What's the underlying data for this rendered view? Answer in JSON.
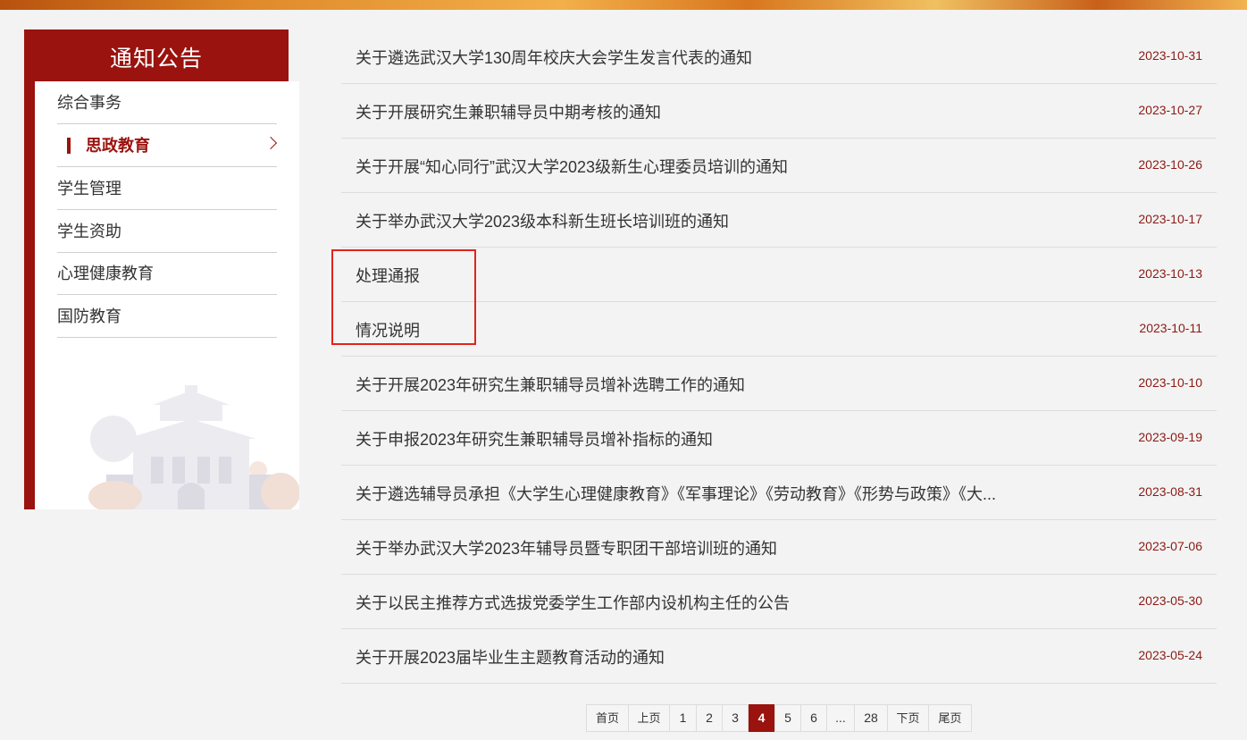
{
  "sidebar": {
    "title": "通知公告",
    "items": [
      {
        "label": "综合事务"
      },
      {
        "label": "思政教育"
      },
      {
        "label": "学生管理"
      },
      {
        "label": "学生资助"
      },
      {
        "label": "心理健康教育"
      },
      {
        "label": "国防教育"
      }
    ],
    "active_index": 1
  },
  "notices": [
    {
      "title": "关于遴选武汉大学130周年校庆大会学生发言代表的通知",
      "date": "2023-10-31"
    },
    {
      "title": "关于开展研究生兼职辅导员中期考核的通知",
      "date": "2023-10-27"
    },
    {
      "title": "关于开展“知心同行”武汉大学2023级新生心理委员培训的通知",
      "date": "2023-10-26"
    },
    {
      "title": "关于举办武汉大学2023级本科新生班长培训班的通知",
      "date": "2023-10-17"
    },
    {
      "title": "处理通报",
      "date": "2023-10-13"
    },
    {
      "title": "情况说明",
      "date": "2023-10-11"
    },
    {
      "title": "关于开展2023年研究生兼职辅导员增补选聘工作的通知",
      "date": "2023-10-10"
    },
    {
      "title": "关于申报2023年研究生兼职辅导员增补指标的通知",
      "date": "2023-09-19"
    },
    {
      "title": "关于遴选辅导员承担《大学生心理健康教育》《军事理论》《劳动教育》《形势与政策》《大...",
      "date": "2023-08-31"
    },
    {
      "title": "关于举办武汉大学2023年辅导员暨专职团干部培训班的通知",
      "date": "2023-07-06"
    },
    {
      "title": "关于以民主推荐方式选拔党委学生工作部内设机构主任的公告",
      "date": "2023-05-30"
    },
    {
      "title": "关于开展2023届毕业生主题教育活动的通知",
      "date": "2023-05-24"
    }
  ],
  "pagination": {
    "first": "首页",
    "prev": "上页",
    "pages": [
      "1",
      "2",
      "3",
      "4",
      "5",
      "6"
    ],
    "ellipsis": "...",
    "last_page": "28",
    "next": "下页",
    "last": "尾页",
    "current": "4"
  },
  "colors": {
    "brand": "#9a130e",
    "date": "#8b1a14",
    "highlight": "#e2231a"
  }
}
